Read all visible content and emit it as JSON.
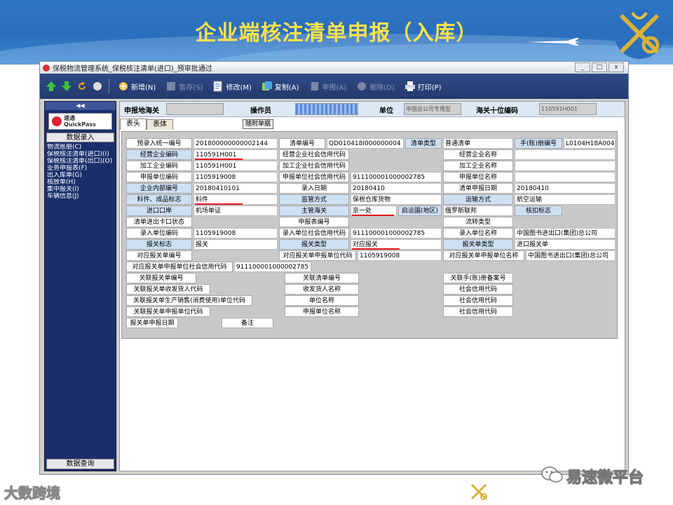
{
  "slide": {
    "title": "企业端核注清单申报（入库）",
    "watermark_left": "大数跨境",
    "watermark_right": "易速微平台"
  },
  "window": {
    "title": "保税物流管理系统_保税核注清单(进口)_预审批通过",
    "minimize": "_",
    "maximize": "□",
    "close": "x"
  },
  "toolbar": {
    "new": "新增(N)",
    "save": "暂存(S)",
    "edit": "修改(M)",
    "copy": "复制(A)",
    "declare": "申报(A)",
    "delete": "删除(D)",
    "print": "打印(P)"
  },
  "sidebar": {
    "collapse": "◀◀",
    "logo_cn": "速通",
    "logo_en": "QuickPass",
    "section": "数据录入",
    "items": [
      "物流账册(C)",
      "保税核注清单(进口)(I)",
      "保税核注清单(出口)(O)",
      "业务申报表(F)",
      "出入库单(G)",
      "核放单(H)",
      "集中报关(I)",
      "车辆信息(J)"
    ],
    "footer": "数据查询"
  },
  "header": {
    "customs_label": "申报地海关",
    "customs_value": "",
    "operator_label": "操作员",
    "operator_value": "",
    "unit_label": "单位",
    "unit_value": "中国总公司专用型",
    "code_label": "海关十位编码",
    "code_value": "110591H001"
  },
  "tabs": [
    "表头",
    "表体"
  ],
  "attach_button": "随附单据",
  "form": {
    "r1": {
      "a": "预录入统一编号",
      "av": "201800000000002144",
      "b": "清单编号",
      "bv": "QD010418I000000004",
      "c": "清单类型",
      "cv": "普通清单",
      "d": "手(账)册编号",
      "dv": "L0104H18A004"
    },
    "r2": {
      "a": "经营企业编码",
      "av": "110591H001",
      "b": "经营企业社会信用代码",
      "bv": "",
      "c": "经营企业名称",
      "cv": ""
    },
    "r3": {
      "a": "加工企业编码",
      "av": "110591H001",
      "b": "加工企业社会信用代码",
      "bv": "",
      "c": "加工企业名称",
      "cv": ""
    },
    "r4": {
      "a": "申报单位编码",
      "av": "1105919008",
      "b": "申报单位社会信用代码",
      "bv": "911100001000002785",
      "c": "申报单位名称",
      "cv": ""
    },
    "r5": {
      "a": "企业内部编号",
      "av": "20180410101",
      "b": "录入日期",
      "bv": "20180410",
      "c": "清单申报日期",
      "cv": "20180410"
    },
    "r6": {
      "a": "料件、成品标志",
      "av": "料件",
      "b": "监管方式",
      "bv": "保税仓库货物",
      "c": "运输方式",
      "cv": "航空运输"
    },
    "r7": {
      "a": "进口口岸",
      "av": "机场单证",
      "b": "主管海关",
      "bv": "京一处",
      "b2": "启运国(地区)",
      "b2v": "俄罗斯联邦",
      "c": "核扣标志",
      "cv": ""
    },
    "r8": {
      "a": "清单进出卡口状态",
      "av": "",
      "b": "申报表编号",
      "bv": "",
      "c": "流转类型",
      "cv": ""
    },
    "r9": {
      "a": "录入单位编码",
      "av": "1105919008",
      "b": "录入单位社会信用代码",
      "bv": "911100001000002785",
      "c": "录入单位名称",
      "cv": "中国图书进出口(集团)总公司"
    },
    "r10": {
      "a": "报关标志",
      "av": "报关",
      "b": "报关类型",
      "bv": "对应报关",
      "c": "报关单类型",
      "cv": "进口报关单"
    },
    "r11": {
      "a": "对应报关单编号",
      "av": "",
      "b": "对应报关单申报单位代码",
      "bv": "1105919008",
      "c": "对应报关单申报单位名称",
      "cv": "中国图书进出口(集团)总公司"
    },
    "r12": {
      "a": "对应报关单申报单位社会信用代码",
      "av": "911100001000002785"
    },
    "r13": {
      "a": "关联报关单编号",
      "av": "",
      "b": "关联清单编号",
      "bv": "",
      "c": "关联手(账)册备案号",
      "cv": ""
    },
    "r14": {
      "a": "关联报关单收发货人代码",
      "av": "",
      "b": "收发货人名称",
      "bv": "",
      "c": "社会信用代码",
      "cv": ""
    },
    "r15": {
      "a": "关联报关单生产销售(消费使用)单位代码",
      "av": "",
      "b": "单位名称",
      "bv": "",
      "c": "社会信用代码",
      "cv": ""
    },
    "r16": {
      "a": "关联报关单申报单位代码",
      "av": "",
      "b": "申报单位名称",
      "bv": "",
      "c": "社会信用代码",
      "cv": ""
    },
    "r17": {
      "a": "报关单申报日期",
      "av": "",
      "b": "备注",
      "bv": ""
    }
  },
  "colors": {
    "banner": "#2f76c4",
    "title": "#ffe24a",
    "toolbar": "#2e4a86",
    "sidebar": "#1a2f6b",
    "highlight_label": "#cde0f4",
    "underline": "#e0141e"
  }
}
